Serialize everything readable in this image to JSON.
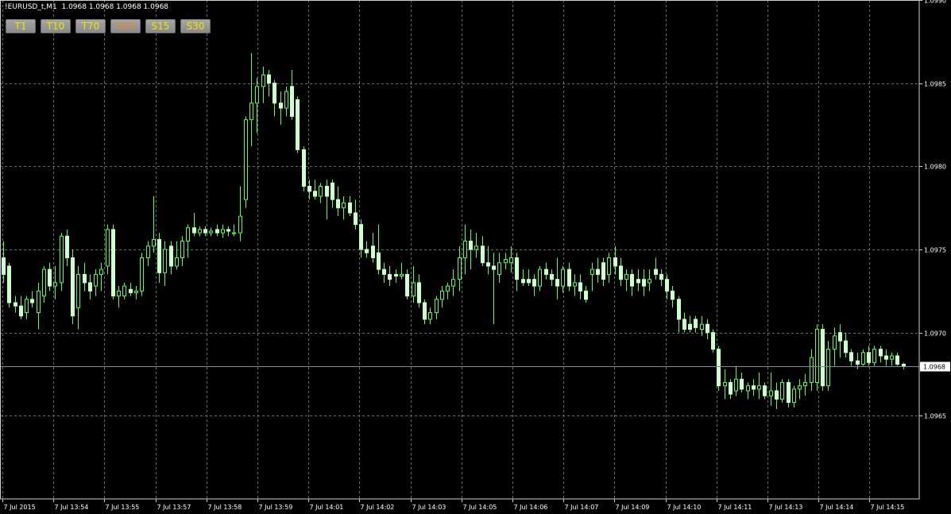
{
  "header": {
    "symbol": "!EURUSD_t,M1",
    "ohlc": "1.0968 1.0968 1.0968 1.0968"
  },
  "toolbar": {
    "buttons": [
      "T1",
      "T10",
      "T70",
      "S10",
      "S15",
      "S30"
    ]
  },
  "current_price_label": "1.0968",
  "colors": {
    "background": "#000000",
    "grid": "#6b6b6b",
    "candle": "#cfffcf",
    "wick": "#55ff55",
    "bid_line": "#7a8aa0",
    "bid_label_bg": "#ffffff",
    "button_text_t": "#f3e300",
    "button_text_s": "#e58a1a"
  },
  "chart_data": {
    "type": "candlestick",
    "title": "!EURUSD_t,M1",
    "grid": true,
    "ylim": [
      1.096,
      1.099
    ],
    "y_ticks": [
      "1.0990",
      "1.0985",
      "1.0980",
      "1.0975",
      "1.0970",
      "1.0965"
    ],
    "x_tick_labels": [
      "7 Jul 2015",
      "7 Jul 13:54",
      "7 Jul 13:55",
      "7 Jul 13:57",
      "7 Jul 13:58",
      "7 Jul 13:59",
      "7 Jul 14:01",
      "7 Jul 14:02",
      "7 Jul 14:03",
      "7 Jul 14:05",
      "7 Jul 14:06",
      "7 Jul 14:07",
      "7 Jul 14:09",
      "7 Jul 14:10",
      "7 Jul 14:11",
      "7 Jul 14:13",
      "7 Jul 14:14",
      "7 Jul 14:15"
    ],
    "current_price": 1.0968,
    "ohlc": [
      [
        1.09745,
        1.09755,
        1.0973,
        1.09735
      ],
      [
        1.0974,
        1.09742,
        1.09715,
        1.09718
      ],
      [
        1.09718,
        1.09722,
        1.09712,
        1.09716
      ],
      [
        1.09716,
        1.09722,
        1.09708,
        1.0971
      ],
      [
        1.09712,
        1.09722,
        1.09708,
        1.0972
      ],
      [
        1.0972,
        1.09725,
        1.09715,
        1.09718
      ],
      [
        1.09712,
        1.0973,
        1.09702,
        1.09725
      ],
      [
        1.09722,
        1.0974,
        1.09718,
        1.09738
      ],
      [
        1.09738,
        1.09742,
        1.09725,
        1.09728
      ],
      [
        1.09728,
        1.0974,
        1.0972,
        1.0973
      ],
      [
        1.0973,
        1.0976,
        1.09725,
        1.09758
      ],
      [
        1.09758,
        1.09762,
        1.0974,
        1.09745
      ],
      [
        1.09745,
        1.0975,
        1.09705,
        1.0971
      ],
      [
        1.09715,
        1.0974,
        1.09702,
        1.09735
      ],
      [
        1.09735,
        1.09742,
        1.09725,
        1.0973
      ],
      [
        1.0973,
        1.09735,
        1.0972,
        1.09725
      ],
      [
        1.09728,
        1.09738,
        1.09722,
        1.09735
      ],
      [
        1.09735,
        1.09742,
        1.09725,
        1.09738
      ],
      [
        1.0974,
        1.09765,
        1.09735,
        1.09762
      ],
      [
        1.09762,
        1.09765,
        1.0972,
        1.09722
      ],
      [
        1.09722,
        1.09728,
        1.09715,
        1.09725
      ],
      [
        1.09722,
        1.0973,
        1.0972,
        1.09728
      ],
      [
        1.09726,
        1.0973,
        1.09722,
        1.09724
      ],
      [
        1.09724,
        1.09728,
        1.0972,
        1.09725
      ],
      [
        1.09725,
        1.09748,
        1.09722,
        1.09745
      ],
      [
        1.09745,
        1.09755,
        1.0974,
        1.09752
      ],
      [
        1.09752,
        1.09782,
        1.09748,
        1.09756
      ],
      [
        1.09756,
        1.0976,
        1.0973,
        1.09736
      ],
      [
        1.09736,
        1.09755,
        1.09728,
        1.0975
      ],
      [
        1.09752,
        1.09755,
        1.09735,
        1.0974
      ],
      [
        1.0974,
        1.09755,
        1.09738,
        1.09745
      ],
      [
        1.09745,
        1.09758,
        1.0974,
        1.09755
      ],
      [
        1.09755,
        1.09765,
        1.09745,
        1.09763
      ],
      [
        1.09763,
        1.09772,
        1.09758,
        1.0976
      ],
      [
        1.0976,
        1.09764,
        1.09758,
        1.09762
      ],
      [
        1.09762,
        1.09764,
        1.09758,
        1.0976
      ],
      [
        1.0976,
        1.09763,
        1.09758,
        1.09761
      ],
      [
        1.09762,
        1.09765,
        1.09758,
        1.0976
      ],
      [
        1.0976,
        1.09765,
        1.09757,
        1.09762
      ],
      [
        1.09762,
        1.09764,
        1.09758,
        1.09761
      ],
      [
        1.0976,
        1.09765,
        1.09758,
        1.0976
      ],
      [
        1.0976,
        1.09788,
        1.09755,
        1.0977
      ],
      [
        1.0978,
        1.0983,
        1.09775,
        1.09828
      ],
      [
        1.09828,
        1.09868,
        1.09812,
        1.09838
      ],
      [
        1.09838,
        1.09853,
        1.0982,
        1.09848
      ],
      [
        1.09848,
        1.0986,
        1.09838,
        1.09855
      ],
      [
        1.09855,
        1.09858,
        1.09842,
        1.0985
      ],
      [
        1.0985,
        1.09852,
        1.0983,
        1.09838
      ],
      [
        1.09838,
        1.09845,
        1.09825,
        1.09835
      ],
      [
        1.09835,
        1.09848,
        1.0983,
        1.09845
      ],
      [
        1.09848,
        1.09858,
        1.09828,
        1.0983
      ],
      [
        1.0984,
        1.09842,
        1.09808,
        1.0981
      ],
      [
        1.0981,
        1.09812,
        1.09785,
        1.09788
      ],
      [
        1.09788,
        1.09792,
        1.0978,
        1.09785
      ],
      [
        1.09785,
        1.09792,
        1.0978,
        1.09782
      ],
      [
        1.09782,
        1.0979,
        1.09778,
        1.09788
      ],
      [
        1.09788,
        1.09792,
        1.09768,
        1.09782
      ],
      [
        1.0979,
        1.09792,
        1.09775,
        1.0978
      ],
      [
        1.0978,
        1.09788,
        1.0977,
        1.09775
      ],
      [
        1.09775,
        1.09782,
        1.09768,
        1.09778
      ],
      [
        1.09778,
        1.09782,
        1.0977,
        1.09772
      ],
      [
        1.09772,
        1.0978,
        1.09762,
        1.09765
      ],
      [
        1.09765,
        1.09768,
        1.09745,
        1.0975
      ],
      [
        1.0975,
        1.09755,
        1.09745,
        1.09748
      ],
      [
        1.09752,
        1.0976,
        1.09742,
        1.09745
      ],
      [
        1.09748,
        1.09765,
        1.09735,
        1.09738
      ],
      [
        1.09738,
        1.09742,
        1.0973,
        1.09735
      ],
      [
        1.09735,
        1.0974,
        1.09728,
        1.09732
      ],
      [
        1.09735,
        1.09738,
        1.0973,
        1.09734
      ],
      [
        1.09734,
        1.09742,
        1.09732,
        1.09735
      ],
      [
        1.09735,
        1.09738,
        1.0972,
        1.09722
      ],
      [
        1.09722,
        1.0974,
        1.09718,
        1.0973
      ],
      [
        1.0973,
        1.09735,
        1.09715,
        1.09718
      ],
      [
        1.09718,
        1.0972,
        1.09705,
        1.09708
      ],
      [
        1.09708,
        1.09715,
        1.09705,
        1.09712
      ],
      [
        1.09712,
        1.09722,
        1.09708,
        1.0972
      ],
      [
        1.0972,
        1.09728,
        1.09715,
        1.09725
      ],
      [
        1.09725,
        1.0973,
        1.0972,
        1.09728
      ],
      [
        1.09728,
        1.09738,
        1.09722,
        1.09732
      ],
      [
        1.09732,
        1.09752,
        1.09725,
        1.09745
      ],
      [
        1.09745,
        1.09765,
        1.09735,
        1.09755
      ],
      [
        1.09755,
        1.09762,
        1.09738,
        1.0975
      ],
      [
        1.0975,
        1.0976,
        1.09745,
        1.09752
      ],
      [
        1.09752,
        1.09758,
        1.0974,
        1.09742
      ],
      [
        1.09742,
        1.09752,
        1.09735,
        1.0974
      ],
      [
        1.0974,
        1.09748,
        1.09705,
        1.09738
      ],
      [
        1.09735,
        1.09748,
        1.0973,
        1.09742
      ],
      [
        1.09742,
        1.09748,
        1.09738,
        1.09744
      ],
      [
        1.09742,
        1.09752,
        1.09736,
        1.09745
      ],
      [
        1.09745,
        1.09748,
        1.09725,
        1.09732
      ],
      [
        1.09732,
        1.09738,
        1.09728,
        1.0973
      ],
      [
        1.09732,
        1.09738,
        1.09728,
        1.0973
      ],
      [
        1.09732,
        1.09735,
        1.09722,
        1.09728
      ],
      [
        1.09728,
        1.0974,
        1.09725,
        1.09738
      ],
      [
        1.09738,
        1.09742,
        1.09732,
        1.09735
      ],
      [
        1.09735,
        1.09738,
        1.09728,
        1.09732
      ],
      [
        1.09732,
        1.09745,
        1.0972,
        1.09728
      ],
      [
        1.09728,
        1.0974,
        1.09724,
        1.09738
      ],
      [
        1.09738,
        1.09742,
        1.09725,
        1.09728
      ],
      [
        1.09728,
        1.09735,
        1.09722,
        1.0973
      ],
      [
        1.0973,
        1.09735,
        1.0972,
        1.09725
      ],
      [
        1.09725,
        1.09728,
        1.09718,
        1.0972
      ],
      [
        1.09735,
        1.09742,
        1.09725,
        1.09738
      ],
      [
        1.09738,
        1.09745,
        1.0973,
        1.09735
      ],
      [
        1.09742,
        1.09745,
        1.09728,
        1.09732
      ],
      [
        1.09735,
        1.09748,
        1.0973,
        1.09745
      ],
      [
        1.09745,
        1.09752,
        1.09735,
        1.0974
      ],
      [
        1.0974,
        1.09745,
        1.09728,
        1.09732
      ],
      [
        1.09732,
        1.09738,
        1.09725,
        1.09735
      ],
      [
        1.09735,
        1.09738,
        1.09722,
        1.09728
      ],
      [
        1.09732,
        1.09738,
        1.09725,
        1.0973
      ],
      [
        1.09732,
        1.09738,
        1.09722,
        1.09728
      ],
      [
        1.0973,
        1.09738,
        1.09725,
        1.09732
      ],
      [
        1.09738,
        1.09745,
        1.09732,
        1.09735
      ],
      [
        1.09735,
        1.09738,
        1.09728,
        1.09732
      ],
      [
        1.09732,
        1.09735,
        1.0972,
        1.09725
      ],
      [
        1.09725,
        1.09728,
        1.09715,
        1.0972
      ],
      [
        1.0972,
        1.09722,
        1.097,
        1.09708
      ],
      [
        1.09708,
        1.09712,
        1.097,
        1.09702
      ],
      [
        1.09705,
        1.0971,
        1.097,
        1.09702
      ],
      [
        1.09708,
        1.0971,
        1.097,
        1.09703
      ],
      [
        1.09702,
        1.0971,
        1.09698,
        1.09705
      ],
      [
        1.09705,
        1.09708,
        1.09696,
        1.097
      ],
      [
        1.097,
        1.09702,
        1.09688,
        1.0969
      ],
      [
        1.0969,
        1.09692,
        1.09665,
        1.09668
      ],
      [
        1.09668,
        1.09678,
        1.0966,
        1.0967
      ],
      [
        1.0967,
        1.09672,
        1.0966,
        1.09663
      ],
      [
        1.09665,
        1.0968,
        1.09662,
        1.09672
      ],
      [
        1.09672,
        1.09676,
        1.09664,
        1.09666
      ],
      [
        1.09665,
        1.0967,
        1.0966,
        1.09668
      ],
      [
        1.09668,
        1.09672,
        1.09662,
        1.09666
      ],
      [
        1.09666,
        1.09676,
        1.0966,
        1.09668
      ],
      [
        1.09668,
        1.0967,
        1.0966,
        1.09662
      ],
      [
        1.09662,
        1.09676,
        1.09656,
        1.09665
      ],
      [
        1.09665,
        1.0967,
        1.09654,
        1.0966
      ],
      [
        1.0966,
        1.09672,
        1.09658,
        1.0967
      ],
      [
        1.0967,
        1.09672,
        1.09655,
        1.09658
      ],
      [
        1.09658,
        1.09668,
        1.09655,
        1.09666
      ],
      [
        1.09666,
        1.09672,
        1.0966,
        1.09668
      ],
      [
        1.09668,
        1.09675,
        1.09662,
        1.0967
      ],
      [
        1.0967,
        1.0969,
        1.09665,
        1.09685
      ],
      [
        1.0967,
        1.09705,
        1.09665,
        1.09702
      ],
      [
        1.09702,
        1.09705,
        1.09665,
        1.09668
      ],
      [
        1.09668,
        1.09695,
        1.09665,
        1.0969
      ],
      [
        1.0969,
        1.09703,
        1.0968,
        1.09698
      ],
      [
        1.097,
        1.09705,
        1.09685,
        1.09695
      ],
      [
        1.09695,
        1.097,
        1.09685,
        1.09688
      ],
      [
        1.09688,
        1.0969,
        1.0968,
        1.09683
      ],
      [
        1.09683,
        1.09688,
        1.09678,
        1.09681
      ],
      [
        1.09681,
        1.0969,
        1.0968,
        1.09688
      ],
      [
        1.09688,
        1.09692,
        1.0968,
        1.09682
      ],
      [
        1.09682,
        1.09692,
        1.0968,
        1.0969
      ],
      [
        1.0969,
        1.09692,
        1.09682,
        1.09686
      ],
      [
        1.09686,
        1.0969,
        1.0968,
        1.09684
      ],
      [
        1.09684,
        1.09688,
        1.0968,
        1.09686
      ],
      [
        1.09686,
        1.09688,
        1.0968,
        1.09681
      ],
      [
        1.09681,
        1.09682,
        1.09678,
        1.0968
      ]
    ]
  }
}
